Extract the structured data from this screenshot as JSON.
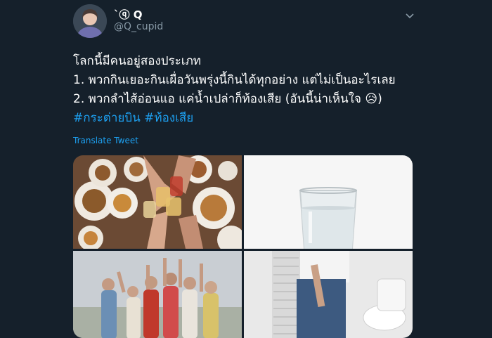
{
  "user": {
    "display_name": "`ⓠ Q",
    "handle": "@Q_cupid"
  },
  "tweet": {
    "lines": [
      "โลกนี้มีคนอยู่สองประเภท",
      "1. พวกกินเยอะกินเผื่อวันพรุ่งนี้กินได้ทุกอย่าง แต่ไม่เป็นอะไรเลย",
      "2. พวกลำไส้อ่อนแอ แค่น้ำเปล่าก็ท้องเสีย (อันนี้น่าเห็นใจ 😥)"
    ],
    "hashtags": "#กระต่ายบิน #ท้องเสีย"
  },
  "translate_label": "Translate Tweet",
  "colors": {
    "background": "#15202b",
    "link": "#1da1f2",
    "secondary_text": "#8899a6"
  },
  "icons": {
    "menu": "chevron-down-icon"
  },
  "media": {
    "images": [
      "food-table-toast-photo",
      "glass-of-water-photo",
      "group-celebrating-photo",
      "person-bathroom-photo"
    ]
  }
}
